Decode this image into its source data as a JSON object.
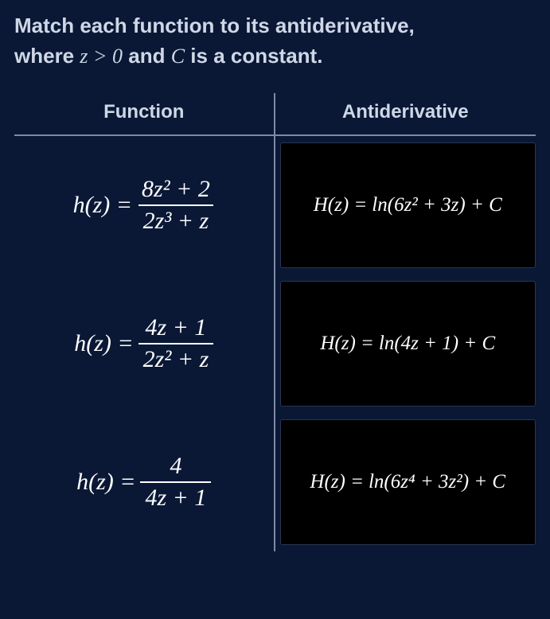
{
  "prompt": {
    "line1_pre": "Match each function to its antiderivative,",
    "line2_pre": "where ",
    "cond_var": "z",
    "cond_rel": " > 0",
    "line2_mid": " and ",
    "const_var": "C",
    "line2_post": " is a constant."
  },
  "headers": {
    "function": "Function",
    "antiderivative": "Antiderivative"
  },
  "rows": [
    {
      "function": {
        "lhs": "h(z) = ",
        "num": "8z² + 2",
        "den": "2z³ + z"
      },
      "antiderivative": {
        "lhs": "H(z) = ",
        "body": "ln(6z² + 3z) + C"
      }
    },
    {
      "function": {
        "lhs": "h(z) = ",
        "num": "4z + 1",
        "den": "2z² + z"
      },
      "antiderivative": {
        "lhs": "H(z) = ",
        "body": "ln(4z + 1) + C"
      }
    },
    {
      "function": {
        "lhs": "h(z) = ",
        "num": "4",
        "den": "4z + 1"
      },
      "antiderivative": {
        "lhs": "H(z) = ",
        "body": "ln(6z⁴ + 3z²) + C"
      }
    }
  ]
}
